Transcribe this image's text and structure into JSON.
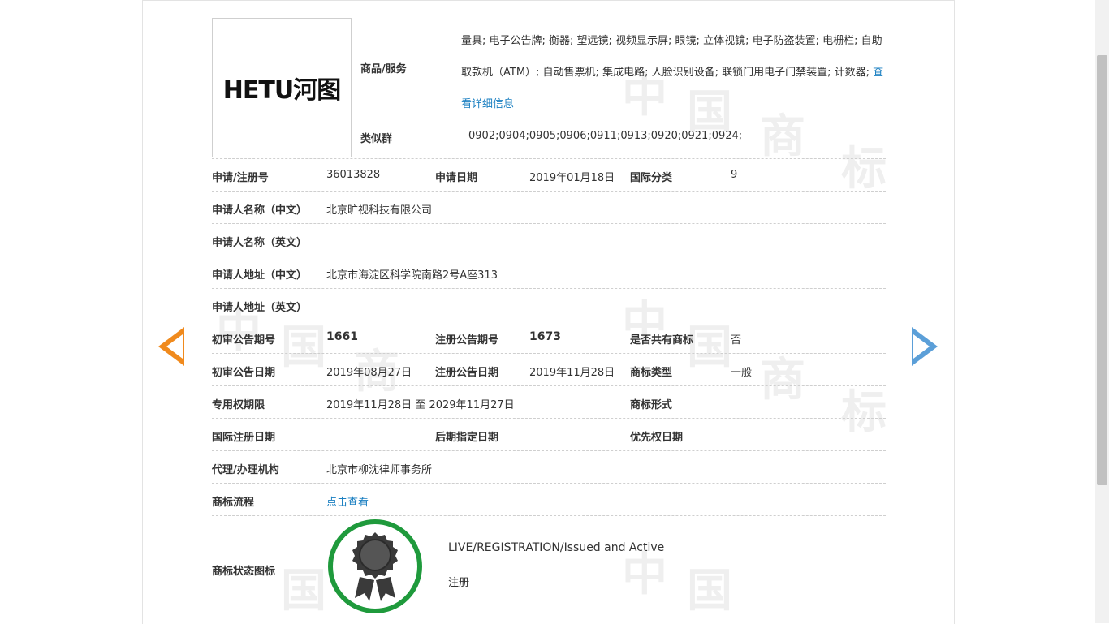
{
  "logo": {
    "text": "HETU河图"
  },
  "goods": {
    "label": "商品/服务",
    "text": "量具; 电子公告牌; 衡器; 望远镜; 视频显示屏; 眼镜; 立体视镜; 电子防盗装置; 电栅栏; 自助取款机（ATM）; 自动售票机; 集成电路; 人脸识别设备; 联锁门用电子门禁装置; 计数器; ",
    "detail_link": "查看详细信息"
  },
  "similar_group": {
    "label": "类似群",
    "value": "0902;0904;0905;0906;0911;0913;0920;0921;0924;"
  },
  "reg_no": {
    "label": "申请/注册号",
    "value": "36013828"
  },
  "apply_date": {
    "label": "申请日期",
    "value": "2019年01月18日"
  },
  "intl_class": {
    "label": "国际分类",
    "value": "9"
  },
  "applicant_cn": {
    "label": "申请人名称（中文）",
    "value": "北京旷视科技有限公司"
  },
  "applicant_en": {
    "label": "申请人名称（英文）",
    "value": ""
  },
  "address_cn": {
    "label": "申请人地址（中文）",
    "value": "北京市海淀区科学院南路2号A座313"
  },
  "address_en": {
    "label": "申请人地址（英文）",
    "value": ""
  },
  "prelim_issue": {
    "label": "初审公告期号",
    "value": "1661"
  },
  "reg_issue": {
    "label": "注册公告期号",
    "value": "1673"
  },
  "shared": {
    "label": "是否共有商标",
    "value": "否"
  },
  "prelim_date": {
    "label": "初审公告日期",
    "value": "2019年08月27日"
  },
  "reg_date": {
    "label": "注册公告日期",
    "value": "2019年11月28日"
  },
  "mark_type": {
    "label": "商标类型",
    "value": "一般"
  },
  "exclusive": {
    "label": "专用权期限",
    "start": "2019年11月28日",
    "sep": "至",
    "end": "2029年11月27日"
  },
  "mark_form": {
    "label": "商标形式",
    "value": ""
  },
  "intl_reg_date": {
    "label": "国际注册日期",
    "value": ""
  },
  "later_date": {
    "label": "后期指定日期",
    "value": ""
  },
  "priority_date": {
    "label": "优先权日期",
    "value": ""
  },
  "agency": {
    "label": "代理/办理机构",
    "value": "北京市柳沈律师事务所"
  },
  "process": {
    "label": "商标流程",
    "link": "点击查看"
  },
  "status": {
    "label": "商标状态图标",
    "en": "LIVE/REGISTRATION/Issued and Active",
    "cn": "注册"
  },
  "colors": {
    "link": "#1a7fc1",
    "arrow_prev": "#f08a1d",
    "arrow_next": "#5b9fd8",
    "badge_ring": "#1f9a3c",
    "badge_icon": "#3a3a3a"
  },
  "icons": {
    "prev": "arrow-left-icon",
    "next": "arrow-right-icon",
    "status": "registered-ribbon-icon"
  }
}
